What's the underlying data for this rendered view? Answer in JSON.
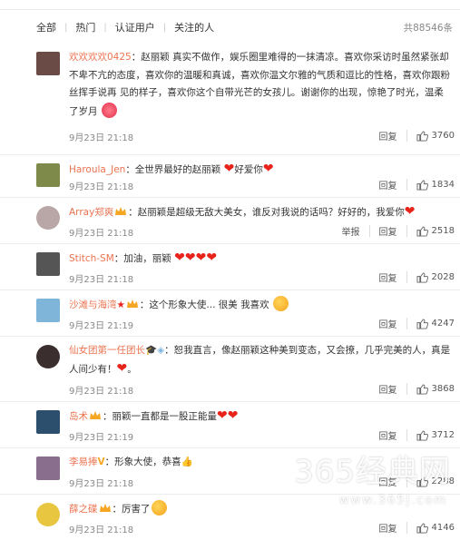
{
  "tabs": [
    "全部",
    "热门",
    "认证用户",
    "关注的人"
  ],
  "total": "共88546条",
  "actions": {
    "reply": "回复",
    "report": "举报"
  },
  "comments": [
    {
      "user": "欢欢欢欢0425",
      "text": "：赵丽颖    真实不做作，娱乐圈里难得的一抹清凉。喜欢你采访时虽然紧张却不卑不亢的态度，喜欢你的温暖和真诚，喜欢你温文尔雅的气质和逗比的性格，喜欢你跟粉丝挥手说再  见的样子，喜欢你这个自带光芒的女孩儿。谢谢你的出现，惊艳了时光，温柔了岁月",
      "time": "9月23日 21:18",
      "likes": "3760",
      "avatar_color": "#6b4b45"
    },
    {
      "user": "Haroula_Jen",
      "text": "：全世界最好的赵丽颖",
      "tail": "好爱你",
      "time": "9月23日 21:18",
      "likes": "1834",
      "avatar_color": "#7d8a4a"
    },
    {
      "user": "Array郑爽",
      "text": "：赵丽颖是超级无敌大美女，谁反对我说的话吗？好好的，我爱你",
      "time": "9月23日 21:18",
      "likes": "2518",
      "avatar_color": "#b9a7a7",
      "report": true
    },
    {
      "user": "Stitch-SM",
      "text": "：加油，丽颖",
      "time": "9月23日 21:18",
      "likes": "2028",
      "avatar_color": "#555"
    },
    {
      "user": "沙滩与海湾",
      "text": "：这个形象大使... 很美 我喜欢",
      "time": "9月23日 21:19",
      "likes": "4247",
      "avatar_color": "#7fb5d9"
    },
    {
      "user": "仙女团第一任团长",
      "text": "：恕我直言，像赵丽颖这种美到变态，又会撩，几乎完美的人，真是人间少有！",
      "time": "9月23日 21:18",
      "likes": "3868",
      "avatar_color": "#3a2e2e"
    },
    {
      "user": "岛术",
      "text": "：丽颖一直都是一股正能量",
      "time": "9月23日 21:19",
      "likes": "3712",
      "avatar_color": "#2d4f6e"
    },
    {
      "user": "李易捧",
      "text": "：形象大使，恭喜",
      "time": "9月23日 21:18",
      "likes": "2288",
      "avatar_color": "#8a6e8e"
    },
    {
      "user": "薛之碟",
      "text": "：厉害了",
      "time": "9月23日 21:18",
      "likes": "4146",
      "avatar_color": "#e8c640"
    }
  ],
  "watermark": {
    "main": "365经典网",
    "sub": "www.365j.com"
  },
  "colors": {
    "username": "#eb7350",
    "heart": "#e8231a"
  }
}
